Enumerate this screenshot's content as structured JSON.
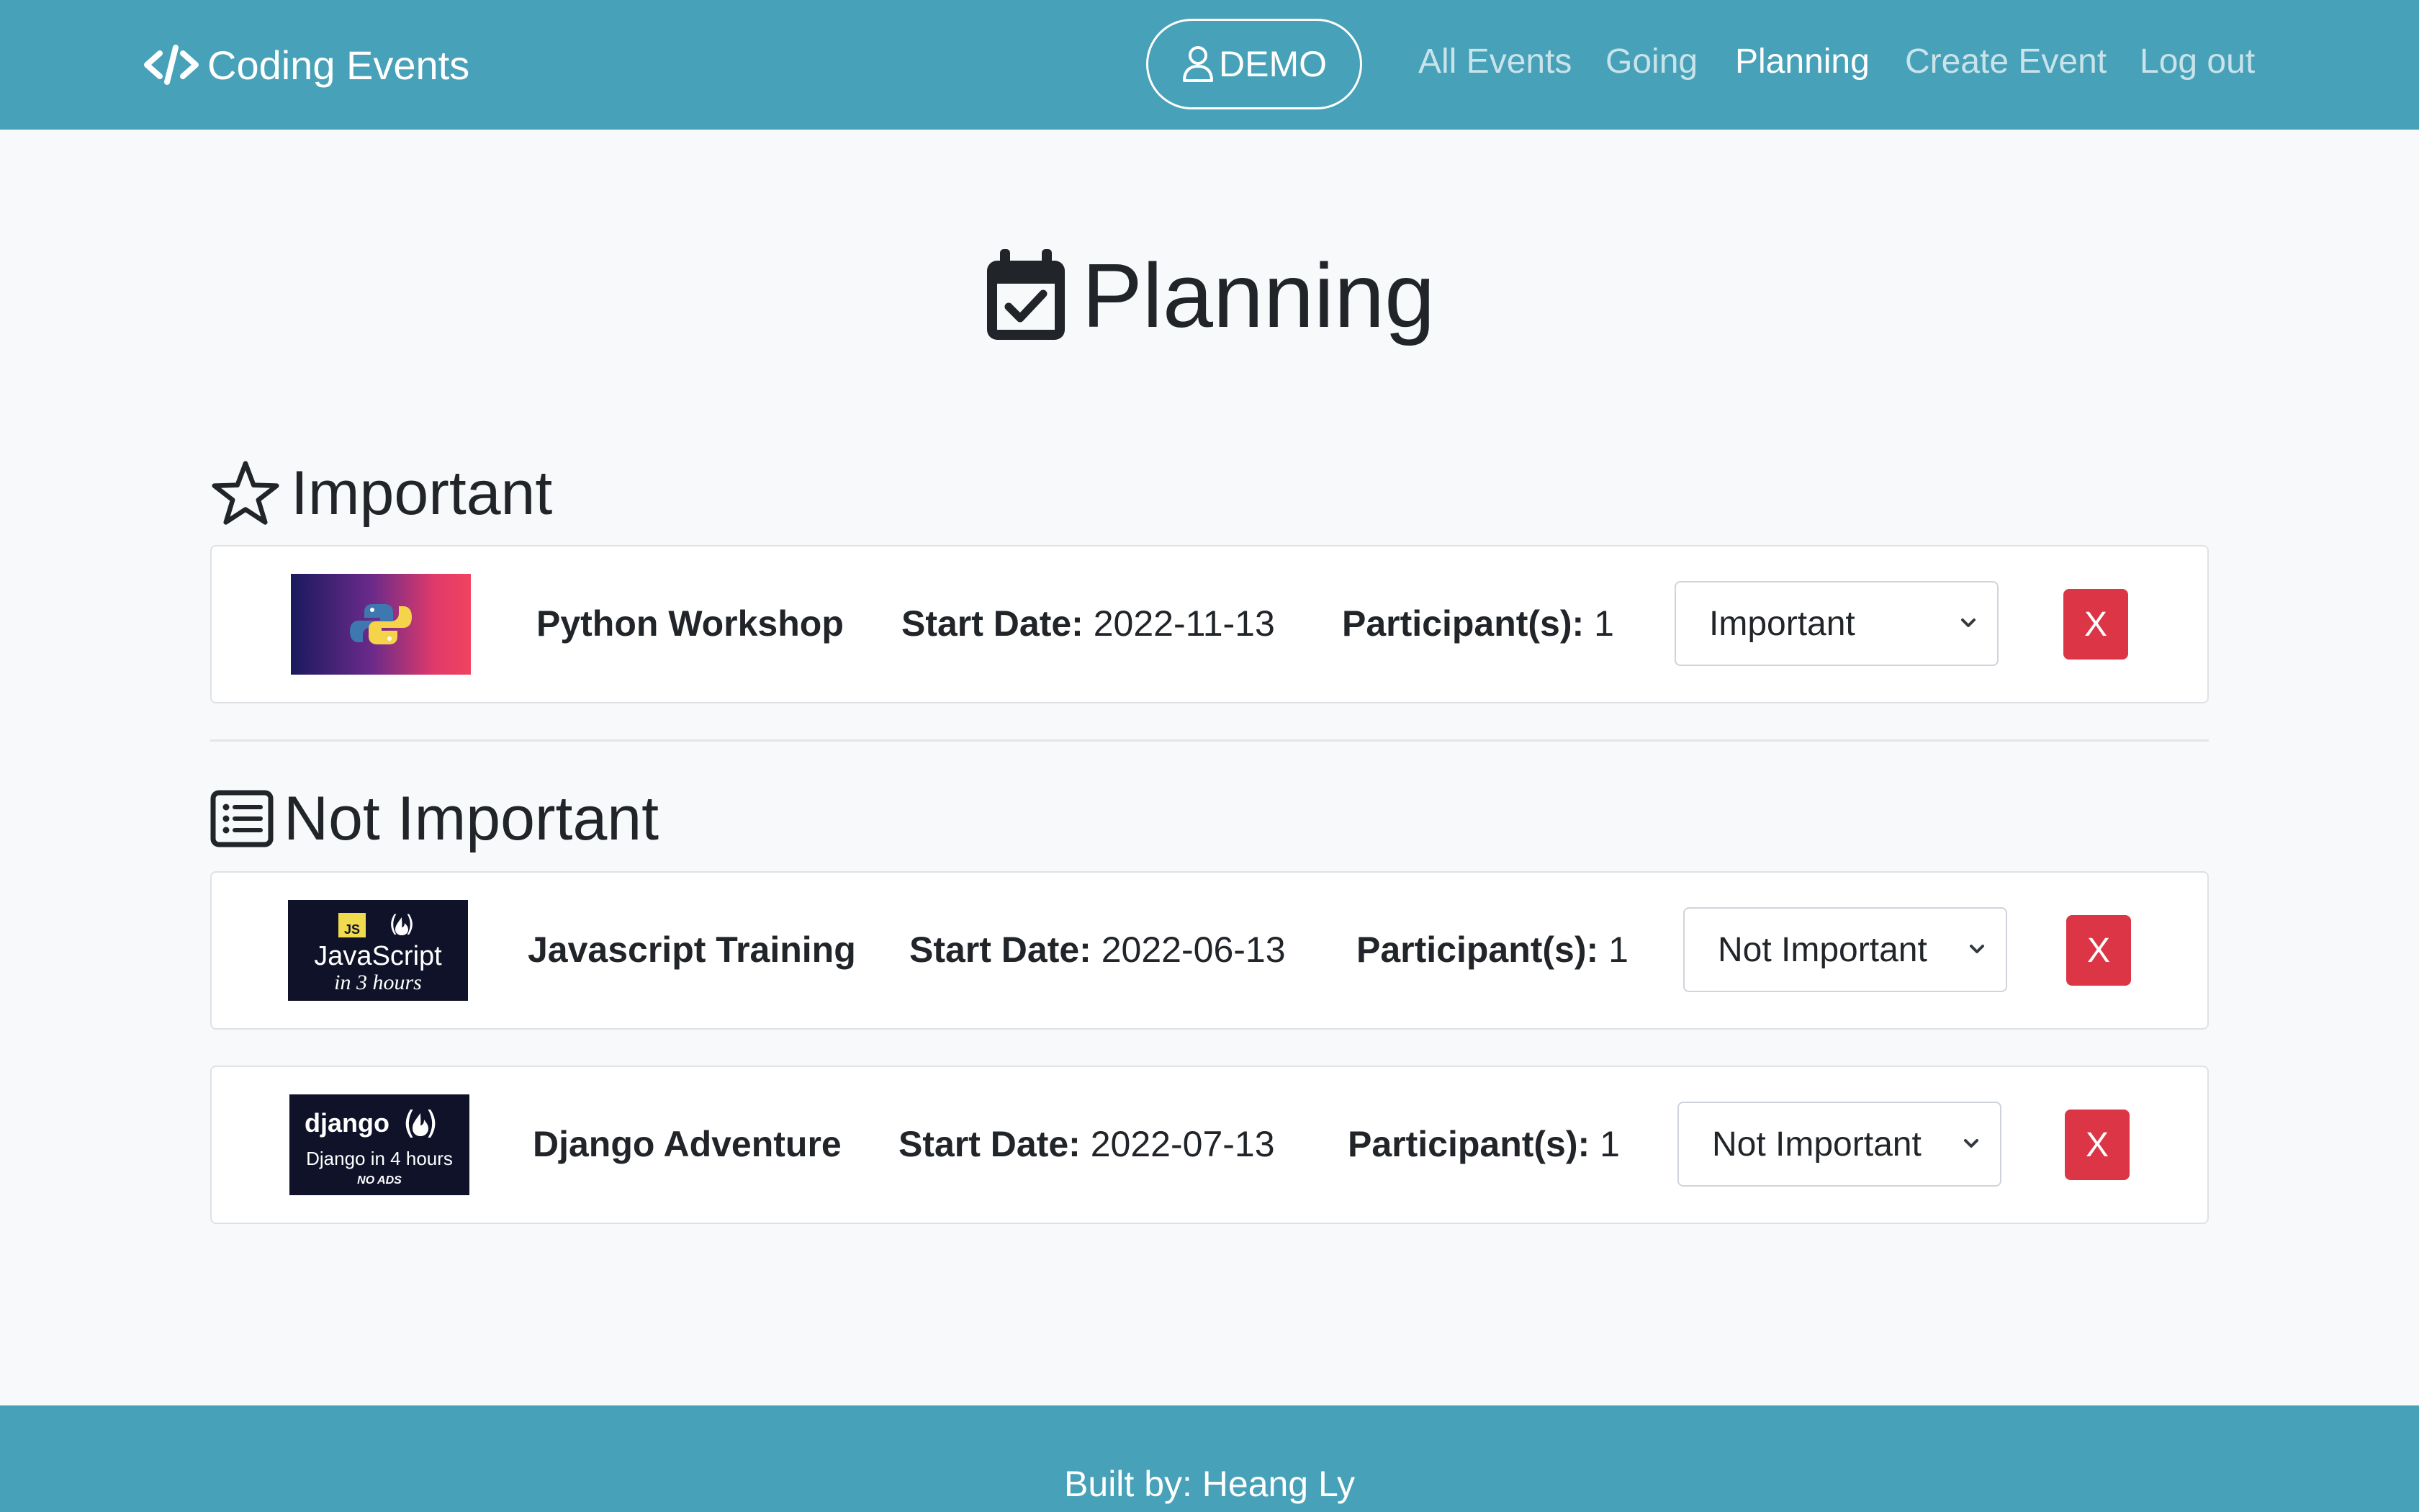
{
  "nav": {
    "brand": "Coding Events",
    "user": "DEMO",
    "links": [
      "All Events",
      "Going",
      "Planning",
      "Create Event",
      "Log out"
    ],
    "active_link": "Planning",
    "color_bar": "#47a1b8"
  },
  "page": {
    "title": "Planning"
  },
  "sections": {
    "important": {
      "heading": "Important",
      "icon": "star-icon",
      "events": [
        {
          "name": "Python Workshop",
          "start_label": "Start Date:",
          "start_date": "2022-11-13",
          "participants_label": "Participant(s):",
          "participants": "1",
          "priority": "Important",
          "remove_label": "X",
          "thumb": "python-logo"
        }
      ]
    },
    "not_important": {
      "heading": "Not Important",
      "icon": "list-icon",
      "events": [
        {
          "name": "Javascript Training",
          "start_label": "Start Date:",
          "start_date": "2022-06-13",
          "participants_label": "Participant(s):",
          "participants": "1",
          "priority": "Not Important",
          "remove_label": "X",
          "thumb_text": {
            "badge": "JS",
            "title": "JavaScript",
            "subtitle": "in 3 hours"
          }
        },
        {
          "name": "Django Adventure",
          "start_label": "Start Date:",
          "start_date": "2022-07-13",
          "participants_label": "Participant(s):",
          "participants": "1",
          "priority": "Not Important",
          "remove_label": "X",
          "thumb_text": {
            "title": "django",
            "subtitle": "Django in 4 hours",
            "note": "NO ADS"
          }
        }
      ]
    }
  },
  "footer": {
    "text": "Built by: Heang Ly"
  },
  "colors": {
    "danger": "#dc3545",
    "background": "#f8f9fa"
  }
}
